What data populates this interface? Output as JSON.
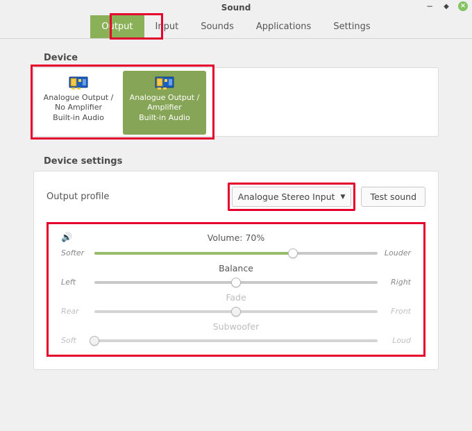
{
  "window": {
    "title": "Sound"
  },
  "tabs": {
    "output": "Output",
    "input": "Input",
    "sounds": "Sounds",
    "applications": "Applications",
    "settings": "Settings"
  },
  "sections": {
    "device": "Device",
    "device_settings": "Device settings"
  },
  "devices": {
    "0": {
      "line1": "Analogue Output /",
      "line2": "No Amplifier",
      "line3": "Built-in Audio"
    },
    "1": {
      "line1": "Analogue Output /",
      "line2": "Amplifier",
      "line3": "Built-in Audio"
    }
  },
  "profile": {
    "label": "Output profile",
    "value": "Analogue Stereo Input",
    "test_button": "Test sound"
  },
  "sliders": {
    "volume": {
      "label": "Volume: 70%",
      "left": "Softer",
      "right": "Louder",
      "pct": 70
    },
    "balance": {
      "label": "Balance",
      "left": "Left",
      "right": "Right",
      "pct": 50
    },
    "fade": {
      "label": "Fade",
      "left": "Rear",
      "right": "Front",
      "pct": 50,
      "disabled": true
    },
    "subwoofer": {
      "label": "Subwoofer",
      "left": "Soft",
      "right": "Loud",
      "pct": 0,
      "disabled": true
    }
  }
}
